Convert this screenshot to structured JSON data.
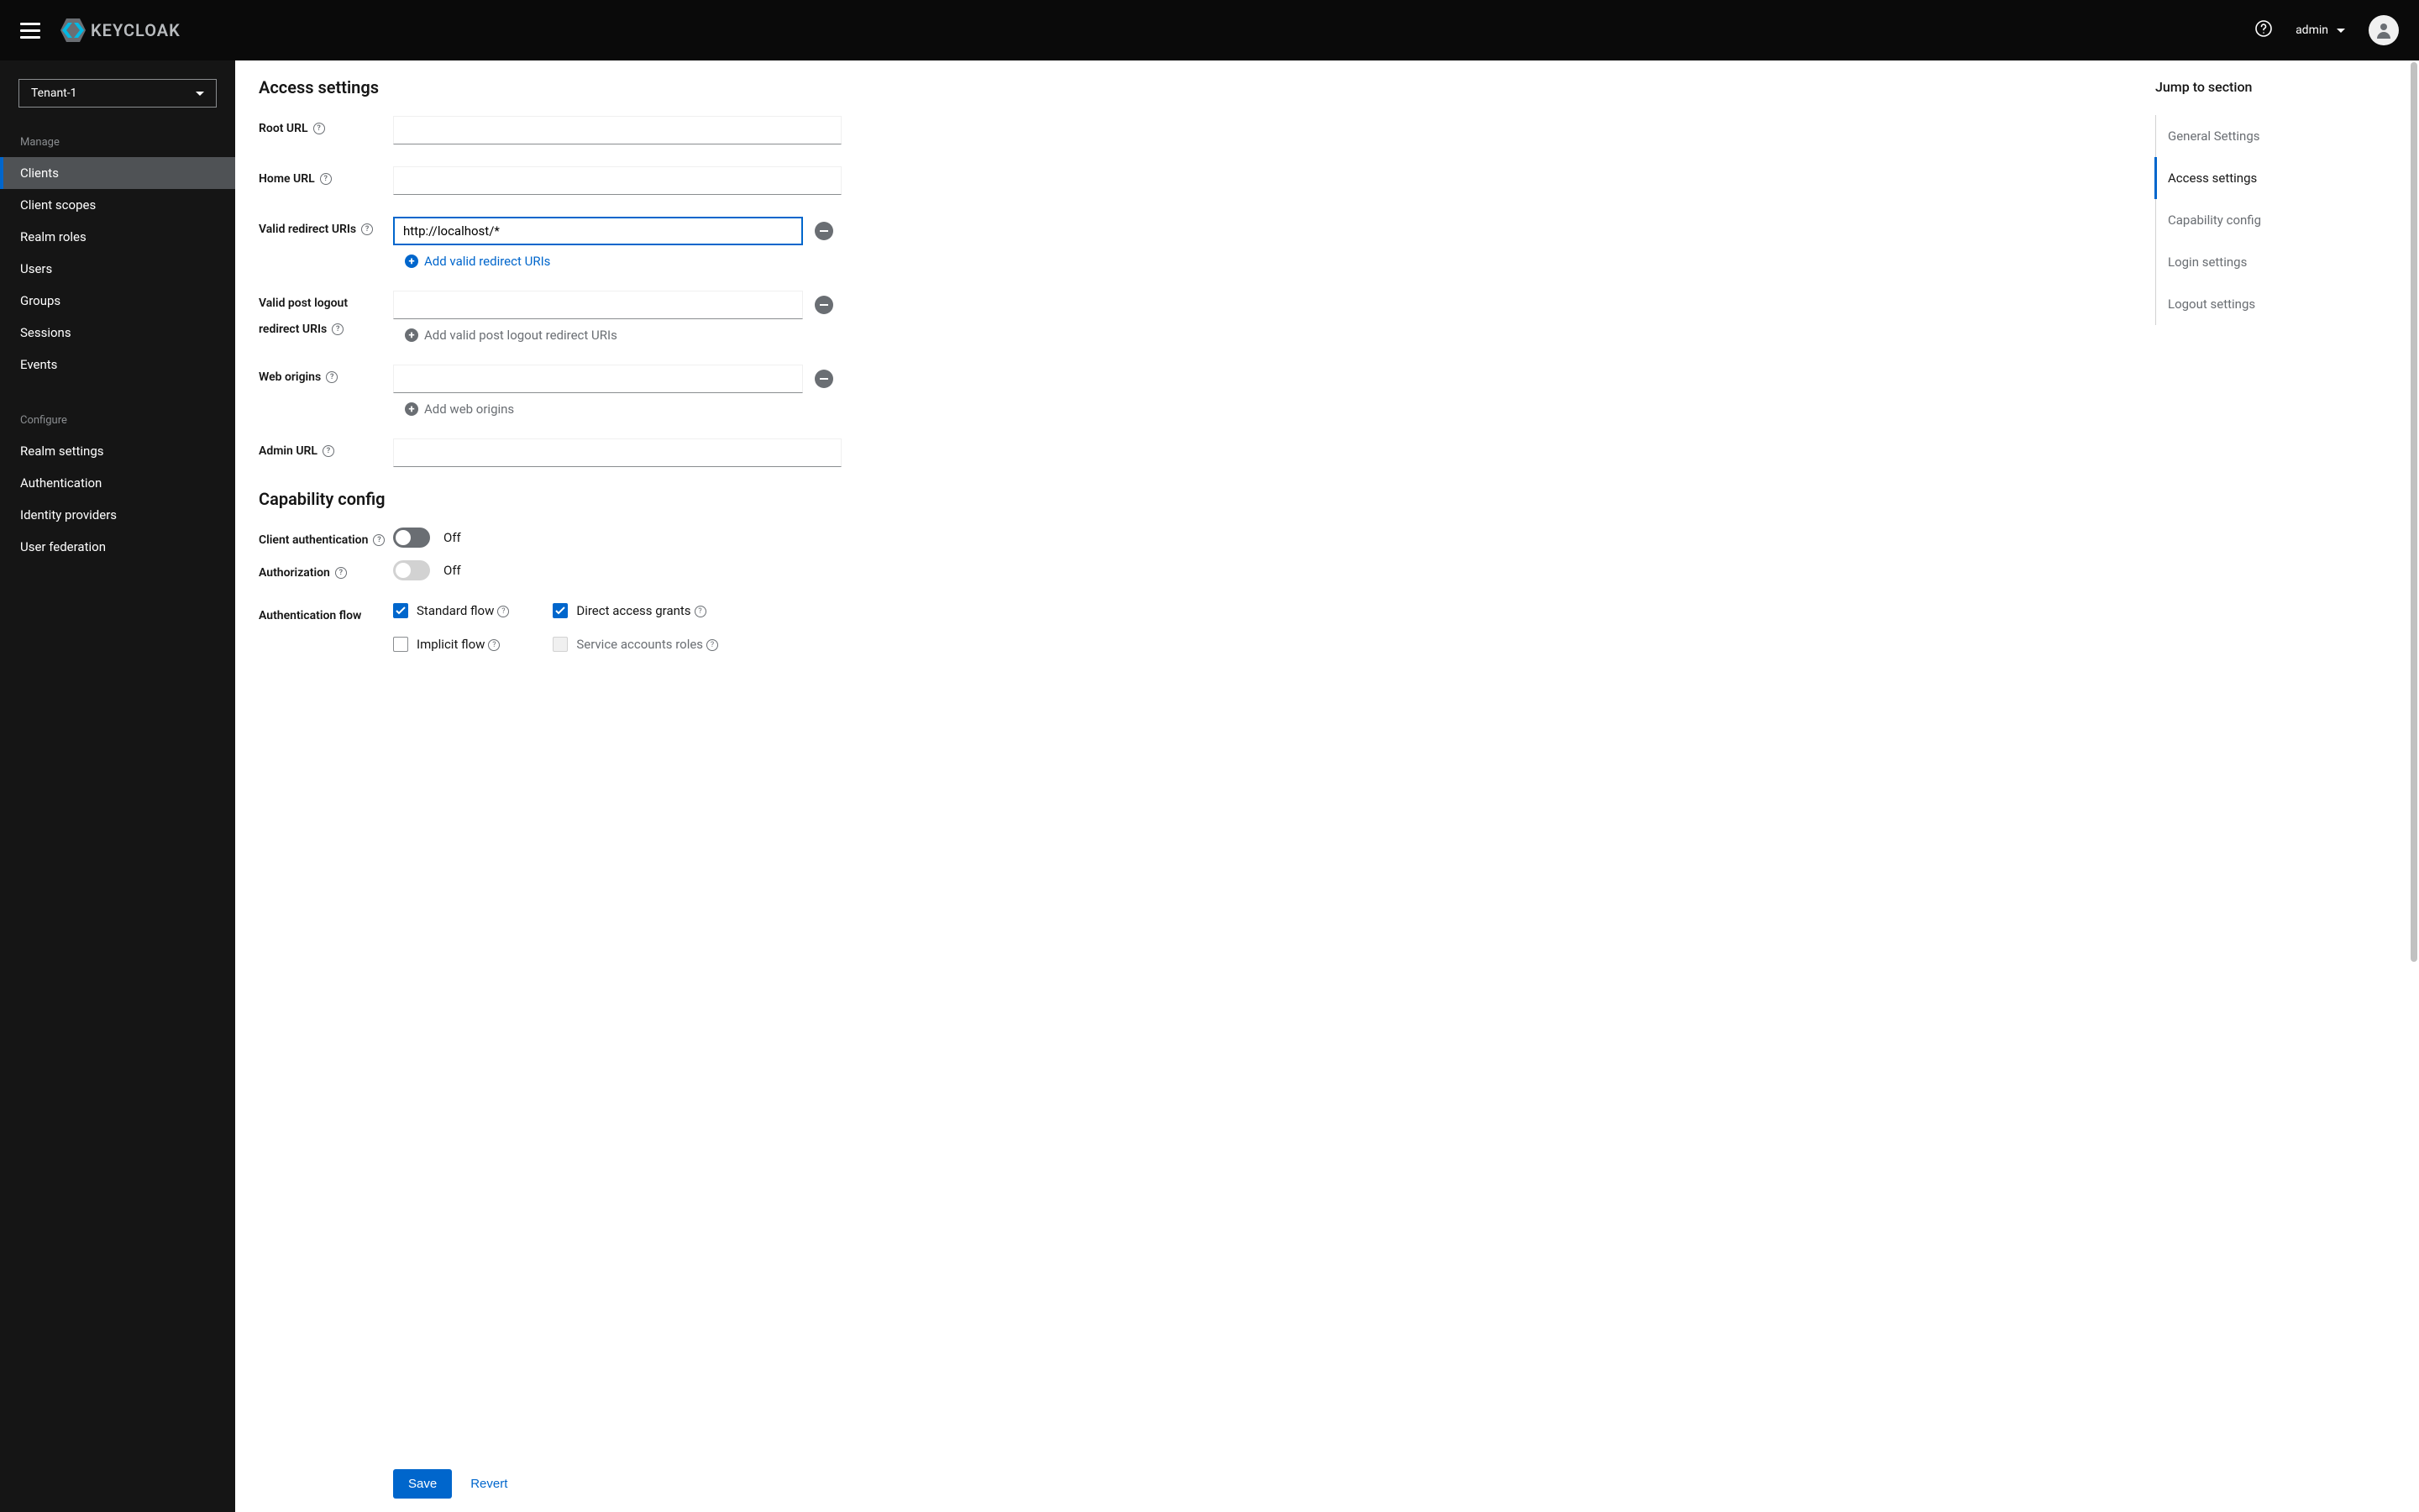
{
  "header": {
    "logo_text": "KEYCLOAK",
    "user_label": "admin"
  },
  "sidebar": {
    "realm_selected": "Tenant-1",
    "manage_title": "Manage",
    "configure_title": "Configure",
    "manage_items": [
      {
        "label": "Clients",
        "active": true
      },
      {
        "label": "Client scopes",
        "active": false
      },
      {
        "label": "Realm roles",
        "active": false
      },
      {
        "label": "Users",
        "active": false
      },
      {
        "label": "Groups",
        "active": false
      },
      {
        "label": "Sessions",
        "active": false
      },
      {
        "label": "Events",
        "active": false
      }
    ],
    "configure_items": [
      {
        "label": "Realm settings"
      },
      {
        "label": "Authentication"
      },
      {
        "label": "Identity providers"
      },
      {
        "label": "User federation"
      }
    ]
  },
  "form": {
    "access_title": "Access settings",
    "capability_title": "Capability config",
    "root_url_label": "Root URL",
    "root_url_value": "",
    "home_url_label": "Home URL",
    "home_url_value": "",
    "valid_redirect_label": "Valid redirect URIs",
    "valid_redirect_value": "http://localhost/*",
    "add_valid_redirect": "Add valid redirect URIs",
    "valid_post_logout_label_1": "Valid post logout",
    "valid_post_logout_label_2": "redirect URIs",
    "valid_post_logout_value": "",
    "add_valid_post_logout": "Add valid post logout redirect URIs",
    "web_origins_label": "Web origins",
    "web_origins_value": "",
    "add_web_origins": "Add web origins",
    "admin_url_label": "Admin URL",
    "admin_url_value": "",
    "client_auth_label": "Client authentication",
    "client_auth_state": "Off",
    "authorization_label": "Authorization",
    "authorization_state": "Off",
    "auth_flow_label": "Authentication flow",
    "standard_flow_label": "Standard flow",
    "implicit_flow_label": "Implicit flow",
    "direct_access_label": "Direct access grants",
    "service_accounts_label": "Service accounts roles",
    "save_label": "Save",
    "revert_label": "Revert"
  },
  "jump": {
    "title": "Jump to section",
    "items": [
      {
        "label": "General Settings",
        "active": false
      },
      {
        "label": "Access settings",
        "active": true
      },
      {
        "label": "Capability config",
        "active": false
      },
      {
        "label": "Login settings",
        "active": false
      },
      {
        "label": "Logout settings",
        "active": false
      }
    ]
  }
}
